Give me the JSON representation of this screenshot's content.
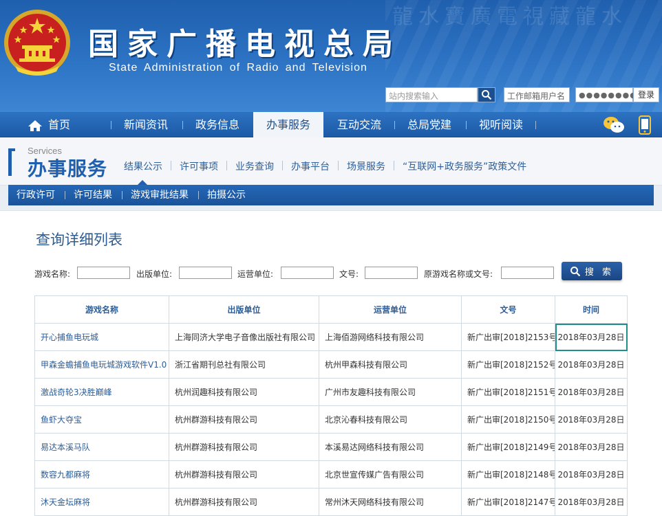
{
  "header": {
    "title": "国家广播电视总局",
    "subtitle": "State Administration of Radio and Television",
    "search_placeholder": "站内搜索输入",
    "mail_user_placeholder": "工作邮箱用户名",
    "mail_password_mask": "●●●●●●●●●",
    "login_label": "登录"
  },
  "main_nav": {
    "items": [
      {
        "label": "首页"
      },
      {
        "label": "新闻资讯"
      },
      {
        "label": "政务信息"
      },
      {
        "label": "办事服务"
      },
      {
        "label": "互动交流"
      },
      {
        "label": "总局党建"
      },
      {
        "label": "视听阅读"
      }
    ],
    "active": "办事服务"
  },
  "section": {
    "english": "Services",
    "chinese": "办事服务",
    "tabs": [
      "结果公示",
      "许可事项",
      "业务查询",
      "办事平台",
      "场景服务",
      "“互联网+政务服务”政策文件"
    ]
  },
  "sub_nav": {
    "items": [
      "行政许可",
      "许可结果",
      "游戏审批结果",
      "拍摄公示"
    ]
  },
  "list": {
    "title": "查询详细列表",
    "filters": {
      "game_name": "游戏名称:",
      "publisher": "出版单位:",
      "operator": "运营单位:",
      "doc_no": "文号:",
      "original": "原游戏名称或文号:"
    },
    "search_button": "搜 索",
    "columns": [
      "游戏名称",
      "出版单位",
      "运营单位",
      "文号",
      "时间"
    ],
    "rows": [
      {
        "name": "开心捕鱼电玩城",
        "publisher": "上海同济大学电子音像出版社有限公司",
        "operator": "上海佰游网络科技有限公司",
        "doc": "新广出审[2018]2153号",
        "date": "2018年03月28日"
      },
      {
        "name": "甲森金蟾捕鱼电玩城游戏软件V1.0",
        "publisher": "浙江省期刊总社有限公司",
        "operator": "杭州甲森科技有限公司",
        "doc": "新广出审[2018]2152号",
        "date": "2018年03月28日"
      },
      {
        "name": "激战奇轮3决胜巅峰",
        "publisher": "杭州润趣科技有限公司",
        "operator": "广州市友趣科技有限公司",
        "doc": "新广出审[2018]2151号",
        "date": "2018年03月28日"
      },
      {
        "name": "鱼虾大夺宝",
        "publisher": "杭州群游科技有限公司",
        "operator": "北京沁春科技有限公司",
        "doc": "新广出审[2018]2150号",
        "date": "2018年03月28日"
      },
      {
        "name": "易达本溪马队",
        "publisher": "杭州群游科技有限公司",
        "operator": "本溪易达网络科技有限公司",
        "doc": "新广出审[2018]2149号",
        "date": "2018年03月28日"
      },
      {
        "name": "数容九都麻将",
        "publisher": "杭州群游科技有限公司",
        "operator": "北京世宣传媒广告有限公司",
        "doc": "新广出审[2018]2148号",
        "date": "2018年03月28日"
      },
      {
        "name": "沐天金坛麻将",
        "publisher": "杭州群游科技有限公司",
        "operator": "常州沐天网络科技有限公司",
        "doc": "新广出审[2018]2147号",
        "date": "2018年03月28日"
      }
    ]
  },
  "colors": {
    "brand_blue": "#1f5fae",
    "link_blue": "#2b5d98",
    "focus_teal": "#1f8f8a"
  }
}
